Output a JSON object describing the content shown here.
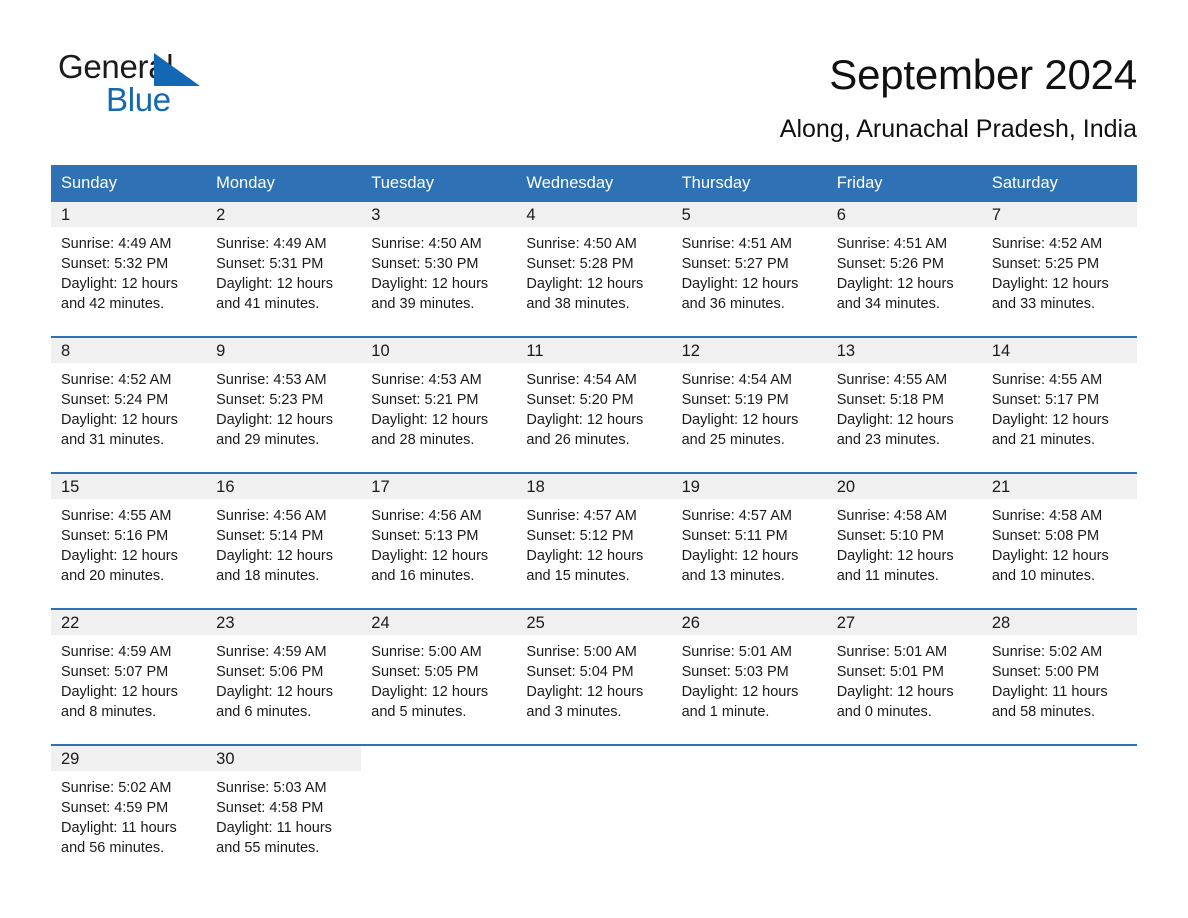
{
  "brand": {
    "name_dark": "General",
    "name_blue": "Blue",
    "triangle_color": "#1268b3"
  },
  "header": {
    "month_title": "September 2024",
    "location": "Along, Arunachal Pradesh, India"
  },
  "theme": {
    "header_blue": "#2e72b5",
    "day_band_gray": "#f0f0f0",
    "text_color": "#1a1a1a"
  },
  "weekdays": [
    "Sunday",
    "Monday",
    "Tuesday",
    "Wednesday",
    "Thursday",
    "Friday",
    "Saturday"
  ],
  "weeks": [
    [
      {
        "day": "1",
        "sunrise": "Sunrise: 4:49 AM",
        "sunset": "Sunset: 5:32 PM",
        "daylight_line1": "Daylight: 12 hours",
        "daylight_line2": "and 42 minutes."
      },
      {
        "day": "2",
        "sunrise": "Sunrise: 4:49 AM",
        "sunset": "Sunset: 5:31 PM",
        "daylight_line1": "Daylight: 12 hours",
        "daylight_line2": "and 41 minutes."
      },
      {
        "day": "3",
        "sunrise": "Sunrise: 4:50 AM",
        "sunset": "Sunset: 5:30 PM",
        "daylight_line1": "Daylight: 12 hours",
        "daylight_line2": "and 39 minutes."
      },
      {
        "day": "4",
        "sunrise": "Sunrise: 4:50 AM",
        "sunset": "Sunset: 5:28 PM",
        "daylight_line1": "Daylight: 12 hours",
        "daylight_line2": "and 38 minutes."
      },
      {
        "day": "5",
        "sunrise": "Sunrise: 4:51 AM",
        "sunset": "Sunset: 5:27 PM",
        "daylight_line1": "Daylight: 12 hours",
        "daylight_line2": "and 36 minutes."
      },
      {
        "day": "6",
        "sunrise": "Sunrise: 4:51 AM",
        "sunset": "Sunset: 5:26 PM",
        "daylight_line1": "Daylight: 12 hours",
        "daylight_line2": "and 34 minutes."
      },
      {
        "day": "7",
        "sunrise": "Sunrise: 4:52 AM",
        "sunset": "Sunset: 5:25 PM",
        "daylight_line1": "Daylight: 12 hours",
        "daylight_line2": "and 33 minutes."
      }
    ],
    [
      {
        "day": "8",
        "sunrise": "Sunrise: 4:52 AM",
        "sunset": "Sunset: 5:24 PM",
        "daylight_line1": "Daylight: 12 hours",
        "daylight_line2": "and 31 minutes."
      },
      {
        "day": "9",
        "sunrise": "Sunrise: 4:53 AM",
        "sunset": "Sunset: 5:23 PM",
        "daylight_line1": "Daylight: 12 hours",
        "daylight_line2": "and 29 minutes."
      },
      {
        "day": "10",
        "sunrise": "Sunrise: 4:53 AM",
        "sunset": "Sunset: 5:21 PM",
        "daylight_line1": "Daylight: 12 hours",
        "daylight_line2": "and 28 minutes."
      },
      {
        "day": "11",
        "sunrise": "Sunrise: 4:54 AM",
        "sunset": "Sunset: 5:20 PM",
        "daylight_line1": "Daylight: 12 hours",
        "daylight_line2": "and 26 minutes."
      },
      {
        "day": "12",
        "sunrise": "Sunrise: 4:54 AM",
        "sunset": "Sunset: 5:19 PM",
        "daylight_line1": "Daylight: 12 hours",
        "daylight_line2": "and 25 minutes."
      },
      {
        "day": "13",
        "sunrise": "Sunrise: 4:55 AM",
        "sunset": "Sunset: 5:18 PM",
        "daylight_line1": "Daylight: 12 hours",
        "daylight_line2": "and 23 minutes."
      },
      {
        "day": "14",
        "sunrise": "Sunrise: 4:55 AM",
        "sunset": "Sunset: 5:17 PM",
        "daylight_line1": "Daylight: 12 hours",
        "daylight_line2": "and 21 minutes."
      }
    ],
    [
      {
        "day": "15",
        "sunrise": "Sunrise: 4:55 AM",
        "sunset": "Sunset: 5:16 PM",
        "daylight_line1": "Daylight: 12 hours",
        "daylight_line2": "and 20 minutes."
      },
      {
        "day": "16",
        "sunrise": "Sunrise: 4:56 AM",
        "sunset": "Sunset: 5:14 PM",
        "daylight_line1": "Daylight: 12 hours",
        "daylight_line2": "and 18 minutes."
      },
      {
        "day": "17",
        "sunrise": "Sunrise: 4:56 AM",
        "sunset": "Sunset: 5:13 PM",
        "daylight_line1": "Daylight: 12 hours",
        "daylight_line2": "and 16 minutes."
      },
      {
        "day": "18",
        "sunrise": "Sunrise: 4:57 AM",
        "sunset": "Sunset: 5:12 PM",
        "daylight_line1": "Daylight: 12 hours",
        "daylight_line2": "and 15 minutes."
      },
      {
        "day": "19",
        "sunrise": "Sunrise: 4:57 AM",
        "sunset": "Sunset: 5:11 PM",
        "daylight_line1": "Daylight: 12 hours",
        "daylight_line2": "and 13 minutes."
      },
      {
        "day": "20",
        "sunrise": "Sunrise: 4:58 AM",
        "sunset": "Sunset: 5:10 PM",
        "daylight_line1": "Daylight: 12 hours",
        "daylight_line2": "and 11 minutes."
      },
      {
        "day": "21",
        "sunrise": "Sunrise: 4:58 AM",
        "sunset": "Sunset: 5:08 PM",
        "daylight_line1": "Daylight: 12 hours",
        "daylight_line2": "and 10 minutes."
      }
    ],
    [
      {
        "day": "22",
        "sunrise": "Sunrise: 4:59 AM",
        "sunset": "Sunset: 5:07 PM",
        "daylight_line1": "Daylight: 12 hours",
        "daylight_line2": "and 8 minutes."
      },
      {
        "day": "23",
        "sunrise": "Sunrise: 4:59 AM",
        "sunset": "Sunset: 5:06 PM",
        "daylight_line1": "Daylight: 12 hours",
        "daylight_line2": "and 6 minutes."
      },
      {
        "day": "24",
        "sunrise": "Sunrise: 5:00 AM",
        "sunset": "Sunset: 5:05 PM",
        "daylight_line1": "Daylight: 12 hours",
        "daylight_line2": "and 5 minutes."
      },
      {
        "day": "25",
        "sunrise": "Sunrise: 5:00 AM",
        "sunset": "Sunset: 5:04 PM",
        "daylight_line1": "Daylight: 12 hours",
        "daylight_line2": "and 3 minutes."
      },
      {
        "day": "26",
        "sunrise": "Sunrise: 5:01 AM",
        "sunset": "Sunset: 5:03 PM",
        "daylight_line1": "Daylight: 12 hours",
        "daylight_line2": "and 1 minute."
      },
      {
        "day": "27",
        "sunrise": "Sunrise: 5:01 AM",
        "sunset": "Sunset: 5:01 PM",
        "daylight_line1": "Daylight: 12 hours",
        "daylight_line2": "and 0 minutes."
      },
      {
        "day": "28",
        "sunrise": "Sunrise: 5:02 AM",
        "sunset": "Sunset: 5:00 PM",
        "daylight_line1": "Daylight: 11 hours",
        "daylight_line2": "and 58 minutes."
      }
    ],
    [
      {
        "day": "29",
        "sunrise": "Sunrise: 5:02 AM",
        "sunset": "Sunset: 4:59 PM",
        "daylight_line1": "Daylight: 11 hours",
        "daylight_line2": "and 56 minutes."
      },
      {
        "day": "30",
        "sunrise": "Sunrise: 5:03 AM",
        "sunset": "Sunset: 4:58 PM",
        "daylight_line1": "Daylight: 11 hours",
        "daylight_line2": "and 55 minutes."
      },
      {
        "day": "",
        "sunrise": "",
        "sunset": "",
        "daylight_line1": "",
        "daylight_line2": ""
      },
      {
        "day": "",
        "sunrise": "",
        "sunset": "",
        "daylight_line1": "",
        "daylight_line2": ""
      },
      {
        "day": "",
        "sunrise": "",
        "sunset": "",
        "daylight_line1": "",
        "daylight_line2": ""
      },
      {
        "day": "",
        "sunrise": "",
        "sunset": "",
        "daylight_line1": "",
        "daylight_line2": ""
      },
      {
        "day": "",
        "sunrise": "",
        "sunset": "",
        "daylight_line1": "",
        "daylight_line2": ""
      }
    ]
  ]
}
